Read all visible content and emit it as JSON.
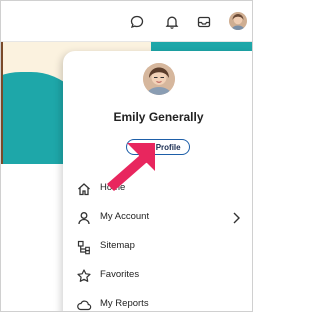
{
  "user": {
    "name": "Emily Generally",
    "view_profile_label": "View Profile"
  },
  "menu": {
    "items": [
      {
        "label": "Home",
        "icon": "home-icon"
      },
      {
        "label": "My Account",
        "icon": "user-icon",
        "has_chevron": true
      },
      {
        "label": "Sitemap",
        "icon": "sitemap-icon"
      },
      {
        "label": "Favorites",
        "icon": "star-icon"
      },
      {
        "label": "My Reports",
        "icon": "cloud-icon"
      }
    ]
  },
  "topbar": {
    "icons": [
      "chat-icon",
      "bell-icon",
      "inbox-icon",
      "avatar"
    ]
  },
  "colors": {
    "accent": "#1e5fa8",
    "teal": "#1ea7a9",
    "arrow": "#e8265e"
  }
}
